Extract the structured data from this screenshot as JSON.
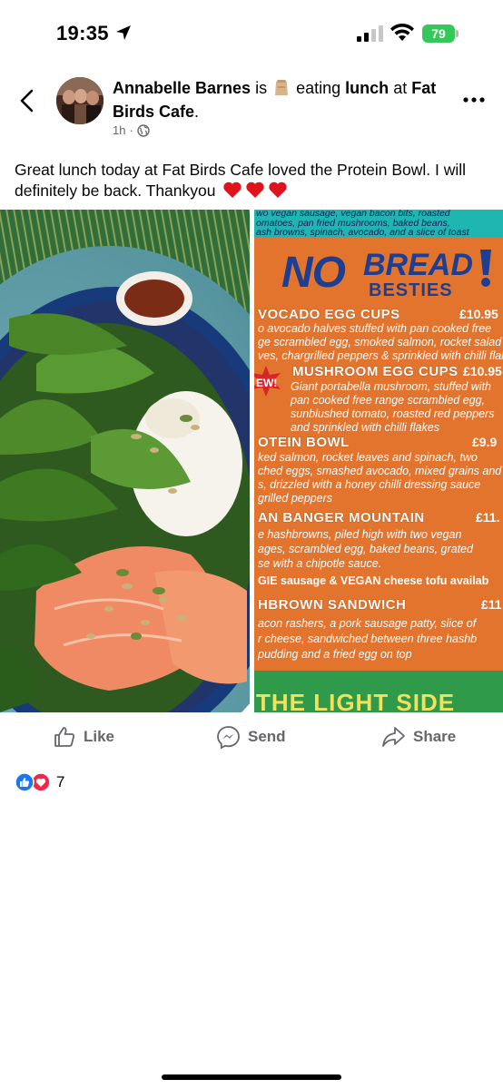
{
  "status_bar": {
    "time": "19:35",
    "battery": "79"
  },
  "post": {
    "author": "Annabelle Barnes",
    "verb_is": "is",
    "activity_emoji": "paper-bag-emoji",
    "activity": "eating",
    "activity_object": "lunch",
    "preposition": "at",
    "place": "Fat Birds Cafe",
    "place_suffix": ".",
    "time_ago": "1h",
    "separator": "·",
    "privacy_icon": "globe-icon",
    "text": "Great lunch today at Fat Birds Cafe loved the Protein Bowl. I will definitely be back. Thankyou"
  },
  "menu_photo": {
    "top_lines": [
      "wo vegan sausage, vegan bacon bits, roasted",
      "omatoes, pan fried mushrooms, baked beans,",
      "ash browns, spinach, avocado, and a slice of toast"
    ],
    "headline_no": "NO",
    "headline_bread": "BREAD",
    "headline_besties": "BESTIES",
    "new_badge": "EW!",
    "items": [
      {
        "title": "VOCADO EGG CUPS",
        "price": "£10.95",
        "desc": [
          "o avocado halves stuffed with pan cooked free",
          "ge scrambled egg, smoked salmon, rocket salad",
          "ves, chargrilled peppers & sprinkled with chilli flake"
        ]
      },
      {
        "title": "MUSHROOM EGG CUPS",
        "price": "£10.95",
        "desc": [
          "Giant portabella mushroom, stuffed with",
          "pan cooked free range scrambled egg,",
          "sunblushed tomato, roasted red peppers",
          "and sprinkled with chilli flakes"
        ]
      },
      {
        "title": "OTEIN BOWL",
        "price": "£9.9",
        "desc": [
          "ked salmon, rocket leaves and spinach, two",
          "ched eggs, smashed avocado, mixed grains and",
          "s, drizzled with a honey chilli dressing sauce",
          "grilled peppers"
        ]
      },
      {
        "title": "AN BANGER MOUNTAIN",
        "price": "£11.",
        "desc": [
          "e hashbrowns, piled high with two vegan",
          "ages, scrambled egg, baked beans, grated",
          "se with a chipotle sauce."
        ]
      },
      {
        "title": "GIE sausage & VEGAN cheese tofu availab",
        "price": "",
        "desc": []
      },
      {
        "title": "HBROWN SANDWICH",
        "price": "£11",
        "desc": [
          "acon rashers, a pork sausage patty, slice of",
          "r cheese, sandwiched between three hashb",
          "pudding and a fried egg on top"
        ]
      }
    ],
    "footer": "THE LIGHT SIDE"
  },
  "actions": {
    "like": "Like",
    "send": "Send",
    "share": "Share"
  },
  "reactions": {
    "count": "7"
  },
  "colors": {
    "accent_blue": "#1877f2",
    "heart_red": "#f02849",
    "menu_orange": "#e2742d",
    "menu_blue": "#1c3f94",
    "battery_green": "#34c759"
  }
}
